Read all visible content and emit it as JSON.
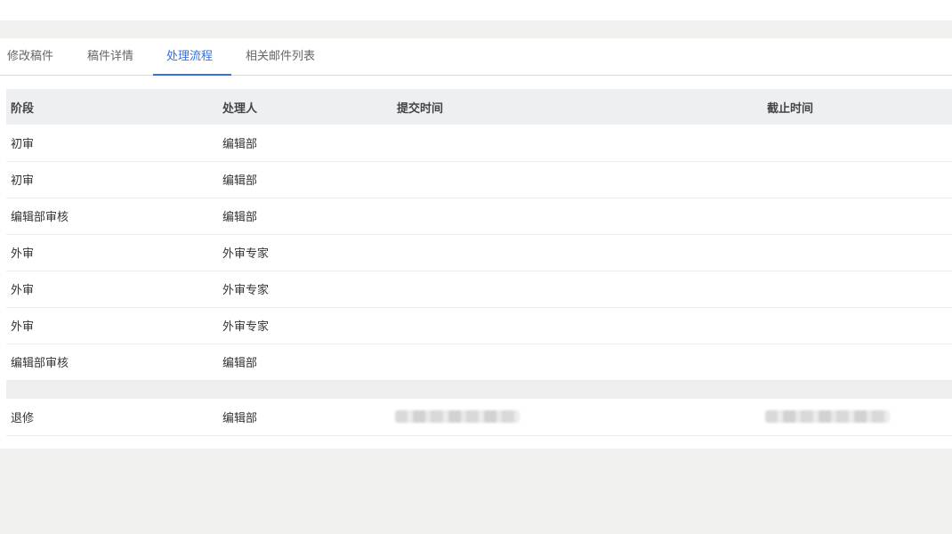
{
  "tabs": [
    {
      "label": "修改稿件",
      "active": false
    },
    {
      "label": "稿件详情",
      "active": false
    },
    {
      "label": "处理流程",
      "active": true
    },
    {
      "label": "相关邮件列表",
      "active": false
    }
  ],
  "table": {
    "headers": {
      "stage": "阶段",
      "handler": "处理人",
      "submit_time": "提交时间",
      "deadline": "截止时间"
    },
    "rows": [
      {
        "stage": "初审",
        "handler": "编辑部",
        "submit_time": "",
        "deadline": ""
      },
      {
        "stage": "初审",
        "handler": "编辑部",
        "submit_time": "",
        "deadline": ""
      },
      {
        "stage": "编辑部审核",
        "handler": "编辑部",
        "submit_time": "",
        "deadline": ""
      },
      {
        "stage": "外审",
        "handler": "外审专家",
        "submit_time": "",
        "deadline": ""
      },
      {
        "stage": "外审",
        "handler": "外审专家",
        "submit_time": "",
        "deadline": ""
      },
      {
        "stage": "外审",
        "handler": "外审专家",
        "submit_time": "",
        "deadline": ""
      },
      {
        "stage": "编辑部审核",
        "handler": "编辑部",
        "submit_time": "",
        "deadline": ""
      }
    ],
    "last_row": {
      "stage": "退修",
      "handler": "编辑部",
      "submit_time_redacted": true,
      "deadline_redacted": true
    }
  },
  "colors": {
    "accent": "#3a6fe0",
    "header_bg": "#edeff2",
    "page_bg": "#f0f0ee"
  }
}
